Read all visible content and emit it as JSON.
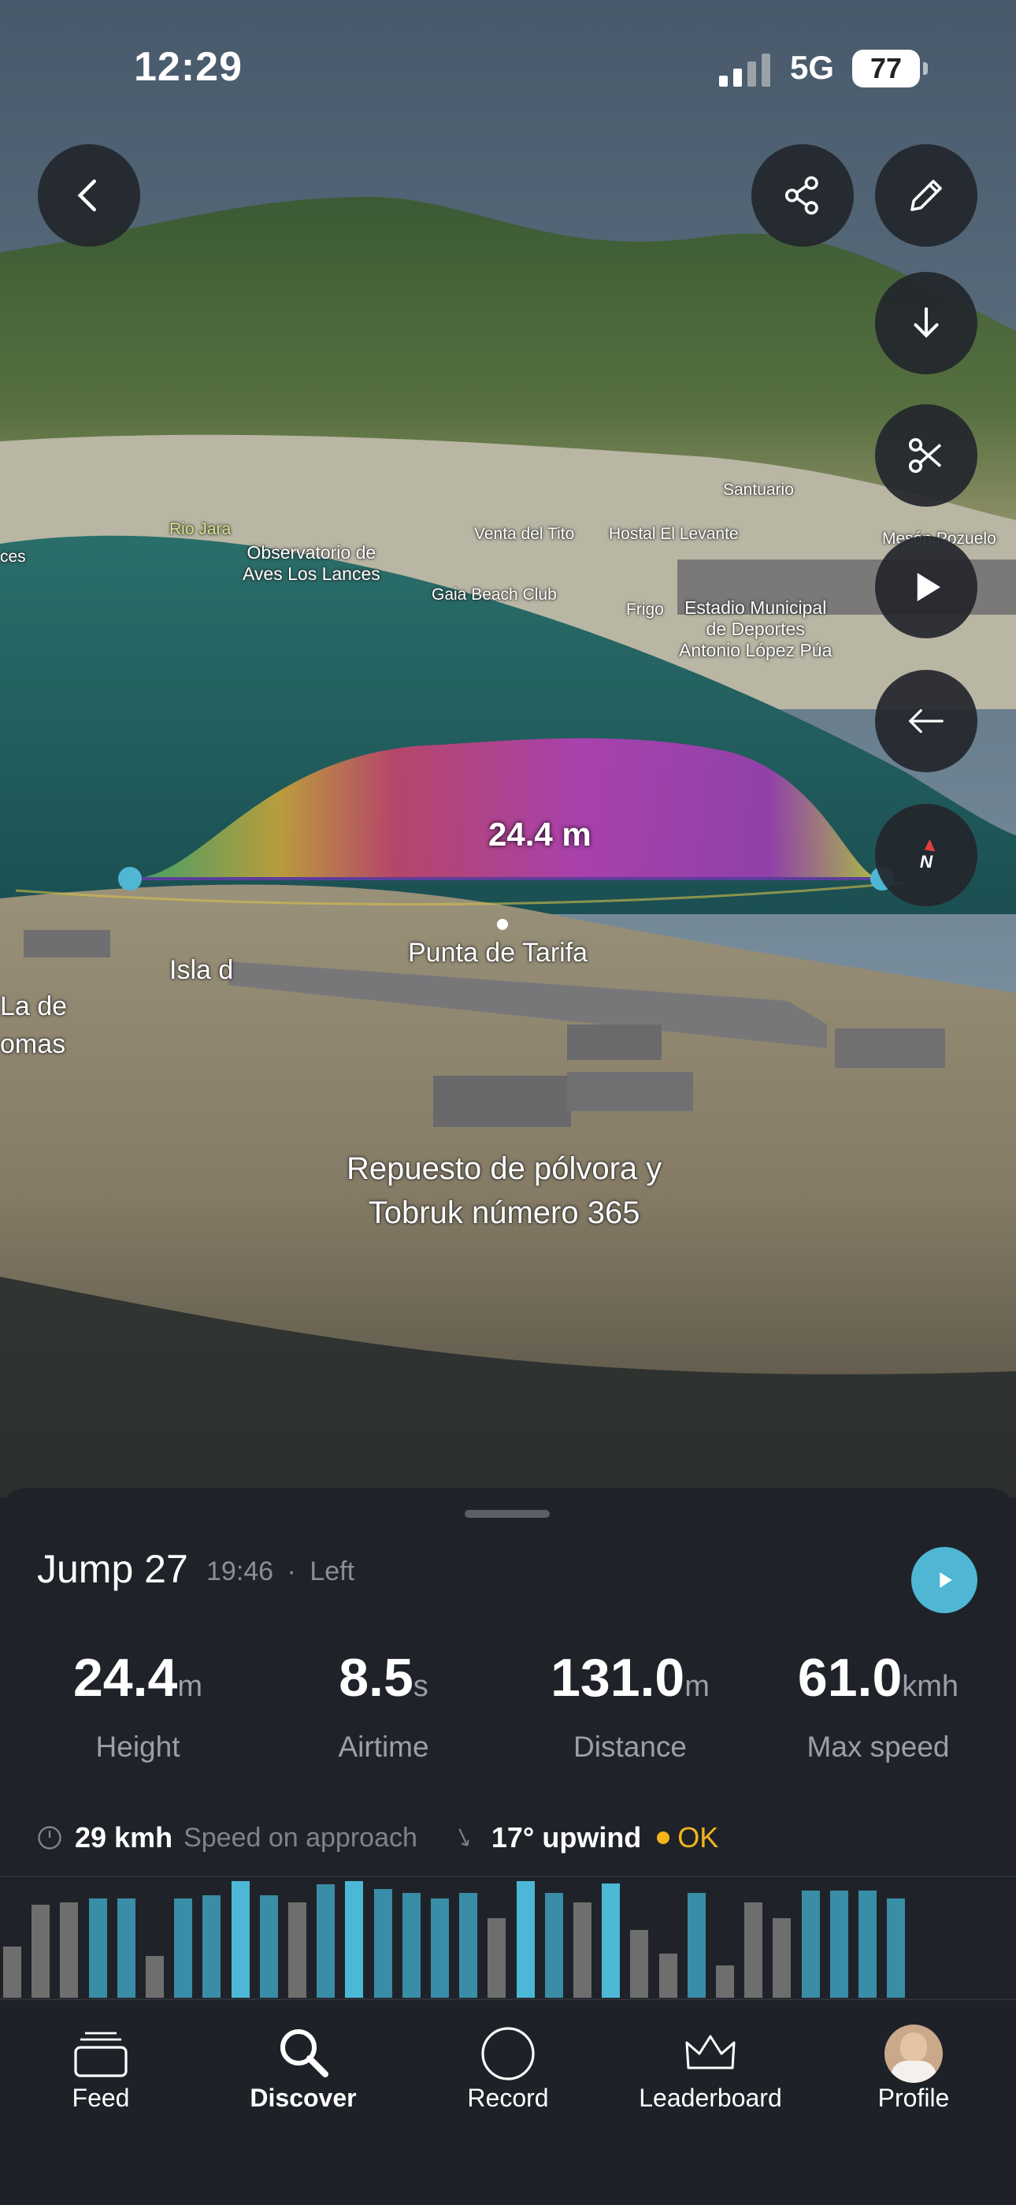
{
  "status_bar": {
    "time": "12:29",
    "network": "5G",
    "battery": "77"
  },
  "map": {
    "jump_height_label": "24.4 m",
    "labels": {
      "rio_jara": "Rio Jara",
      "observatorio": "Observatorio de\nAves Los Lances",
      "venta": "Venta del Tito",
      "hostal": "Hostal El Levante",
      "santuario": "Santuario",
      "meson": "Mesón Pozuelo",
      "gaia": "Gaia Beach Club",
      "frigo": "Frigo",
      "estadio": "Estadio Municipal\nde Deportes\nAntonio López Púa",
      "ces": "ces",
      "punta": "Punta de Tarifa",
      "isla": "Isla d",
      "la_de": "La de",
      "omas": "omas",
      "repuesto": "Repuesto de pólvora y\nTobruk número 365"
    }
  },
  "jump": {
    "title": "Jump 27",
    "time": "19:46",
    "separator": "·",
    "side": "Left",
    "stats": [
      {
        "value": "24.4",
        "unit": "m",
        "label": "Height"
      },
      {
        "value": "8.5",
        "unit": "s",
        "label": "Airtime"
      },
      {
        "value": "131.0",
        "unit": "m",
        "label": "Distance"
      },
      {
        "value": "61.0",
        "unit": "kmh",
        "label": "Max speed"
      }
    ],
    "approach_speed": "29 kmh",
    "approach_label": "Speed on approach",
    "upwind": "17° upwind",
    "status": "OK"
  },
  "bar_chart": {
    "bars": [
      {
        "v": 0.44,
        "c": "#6e6e6e"
      },
      {
        "v": 0.8,
        "c": "#6e6e6e"
      },
      {
        "v": 0.82,
        "c": "#6e6e6e"
      },
      {
        "v": 0.85,
        "c": "#3a8da6"
      },
      {
        "v": 0.85,
        "c": "#3a8da6"
      },
      {
        "v": 0.36,
        "c": "#6e6e6e"
      },
      {
        "v": 0.85,
        "c": "#3a8da6"
      },
      {
        "v": 0.88,
        "c": "#3a8da6"
      },
      {
        "v": 1.0,
        "c": "#4db8d6"
      },
      {
        "v": 0.88,
        "c": "#3a8da6"
      },
      {
        "v": 0.82,
        "c": "#6e6e6e"
      },
      {
        "v": 0.97,
        "c": "#3a8da6"
      },
      {
        "v": 1.0,
        "c": "#4db8d6"
      },
      {
        "v": 0.93,
        "c": "#3a8da6"
      },
      {
        "v": 0.9,
        "c": "#3a8da6"
      },
      {
        "v": 0.85,
        "c": "#3a8da6"
      },
      {
        "v": 0.9,
        "c": "#3a8da6"
      },
      {
        "v": 0.68,
        "c": "#6e6e6e"
      },
      {
        "v": 1.0,
        "c": "#4db8d6"
      },
      {
        "v": 0.9,
        "c": "#3a8da6"
      },
      {
        "v": 0.82,
        "c": "#6e6e6e"
      },
      {
        "v": 0.98,
        "c": "#4db8d6"
      },
      {
        "v": 0.58,
        "c": "#6e6e6e"
      },
      {
        "v": 0.38,
        "c": "#6e6e6e"
      },
      {
        "v": 0.9,
        "c": "#3a8da6"
      },
      {
        "v": 0.28,
        "c": "#6e6e6e"
      },
      {
        "v": 0.82,
        "c": "#6e6e6e"
      },
      {
        "v": 0.68,
        "c": "#6e6e6e"
      },
      {
        "v": 0.92,
        "c": "#3a8da6"
      },
      {
        "v": 0.92,
        "c": "#3a8da6"
      },
      {
        "v": 0.92,
        "c": "#3a8da6"
      },
      {
        "v": 0.85,
        "c": "#3a8da6"
      }
    ]
  },
  "tabs": [
    {
      "label": "Feed",
      "icon": "feed-icon"
    },
    {
      "label": "Discover",
      "icon": "search-icon"
    },
    {
      "label": "Record",
      "icon": "record-icon"
    },
    {
      "label": "Leaderboard",
      "icon": "crown-icon"
    },
    {
      "label": "Profile",
      "icon": "avatar"
    }
  ],
  "colors": {
    "accent": "#4fb7d4",
    "ok": "#f2b51c",
    "sheet": "#1f2329"
  }
}
